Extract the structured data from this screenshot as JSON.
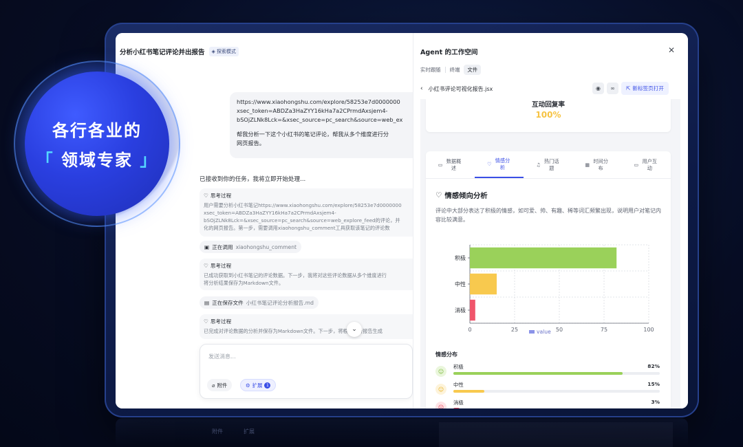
{
  "badge": {
    "line1": "各行各业的",
    "bracket_open": "「",
    "line2": " 领域专家 ",
    "bracket_close": "」"
  },
  "chat": {
    "title": "分析小红书笔记评论并出报告",
    "mode_tag": "探索模式",
    "user_message_lines": [
      "https://www.xiaohongshu.com/explore/58253e7d0000000",
      "xsec_token=ABDZa3HaZYY16kHa7a2CPrmdAxsjem4-",
      "bSOjZLNk8Lck=&xsec_source=pc_search&source=web_ex",
      "",
      "帮我分析一下这个小红书的笔记评论，帮我从多个维度进行分",
      "网页报告。"
    ],
    "reply": "已接收到你的任务，我将立即开始处理...",
    "steps": [
      {
        "label": "思考过程",
        "lines": [
          "用户需要分析小红书笔记https://www.xiaohongshu.com/explore/58253e7d0000000",
          "xsec_token=ABDZa3HaZYY16kHa7a2CPrmdAxsjem4-",
          "bSOjZLNk8Lck=&xsec_source=pc_search&source=web_explore_feed的评论，并",
          "化的网页报告。第一步，需要调用xiaohongshu_comment工具获取该笔记的评论数"
        ]
      },
      {
        "label": "思考过程",
        "lines": [
          "已成功获取到小红书笔记的评论数据。下一步，我将对这些评论数据从多个维度进行",
          "将分析结果保存为Markdown文件。"
        ]
      },
      {
        "label": "思考过程",
        "lines": [
          "已完成对评论数据的分析并保存为Markdown文件。下一步，将根据分析报告生成"
        ]
      }
    ],
    "tool_calls": [
      {
        "status": "正在调用",
        "name": "xiaohongshu_comment"
      },
      {
        "status": "正在保存文件",
        "name": "小红书笔记评论分析报告.md"
      }
    ],
    "composer": {
      "placeholder": "发送消息...",
      "attach_label": "附件",
      "expand_label": "扩展",
      "expand_count": "1"
    }
  },
  "workspace": {
    "title": "Agent 的工作空间",
    "tabs": [
      "实时跟随",
      "终端",
      "文件"
    ],
    "active_tab": "文件",
    "file_name": "小红书评论可视化报告.jsx",
    "open_new_tab_label": "新标签页打开",
    "kpi": {
      "label": "互动回复率",
      "value": "100%"
    },
    "card_tabs": [
      "数据概述",
      "情感分析",
      "热门话题",
      "时间分布",
      "用户互动"
    ],
    "active_card_tab": "情感分析",
    "section_title": "情感倾向分析",
    "section_desc": "评论中大部分表达了积极的情感，如可爱、帅、有趣、稀等词汇频繁出现，说明用户对笔记内容比较满意。",
    "distribution_title": "情感分布",
    "distribution": [
      {
        "name": "积极",
        "percent": "82%",
        "value": 82,
        "color": "#9ad15a",
        "icon_bg": "#eaf6dc",
        "icon_color": "#7dbb3d"
      },
      {
        "name": "中性",
        "percent": "15%",
        "value": 15,
        "color": "#f8c94e",
        "icon_bg": "#fdf3da",
        "icon_color": "#e9b52c"
      },
      {
        "name": "消极",
        "percent": "3%",
        "value": 3,
        "color": "#f0556b",
        "icon_bg": "#fde3e6",
        "icon_color": "#e8475e"
      }
    ]
  },
  "chart_data": {
    "type": "bar",
    "orientation": "horizontal",
    "categories": [
      "积极",
      "中性",
      "消极"
    ],
    "series": [
      {
        "name": "value",
        "values": [
          82,
          15,
          3
        ]
      }
    ],
    "colors": [
      "#9ad15a",
      "#f8c94e",
      "#f0556b"
    ],
    "xlim": [
      0,
      100
    ],
    "xticks": [
      "0",
      "25",
      "50",
      "75",
      "100"
    ],
    "grid": true,
    "legend": "bottom"
  },
  "reflection": {
    "ghost_labels": [
      "附件",
      "扩展"
    ]
  }
}
